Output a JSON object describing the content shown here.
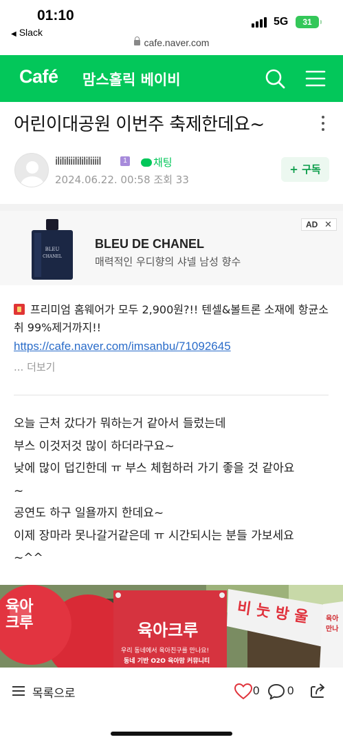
{
  "status_bar": {
    "time": "01:10",
    "back_app": "Slack",
    "network": "5G",
    "battery": "31",
    "url": "cafe.naver.com"
  },
  "header": {
    "logo": "Café",
    "cafe_name": "맘스홀릭 베이비"
  },
  "post": {
    "title": "어린이대공원 이번주 축제한데요~",
    "author": "ilililiiililililiiiil",
    "grade_badge": "1",
    "chat_label": "채팅",
    "date": "2024.06.22. 00:58",
    "views_label": "조회 33",
    "subscribe_label": "+ 구독"
  },
  "ad": {
    "badge": "AD",
    "close": "✕",
    "bottle_text": "BLEU\nCHANEL",
    "brand": "BLEU DE CHANEL",
    "description": "매력적인 우디향의 샤넬 남성 향수"
  },
  "promo": {
    "text": "프리미엄 홈웨어가 모두 2,900원?!! 텐셀&볼트론 소재에 항균소취 99%제거까지!!",
    "link": "https://cafe.naver.com/imsanbu/71092645",
    "more": "... 더보기"
  },
  "body": {
    "lines": [
      "오늘 근처 갔다가 뭐하는거 같아서 들렀는데",
      "부스 이것저것 많이 하더라구요~",
      "낮에 많이 덥긴한데 ㅠ 부스 체험하러 가기 좋을 것 같아요",
      "~",
      "공연도 하구 일욜까지 한데요~",
      "이제 장마라 못나갈거같은데 ㅠ 시간되시는 분들 가보세요",
      "~^^"
    ]
  },
  "photo": {
    "balloon_text": "육아\n크루",
    "banner_title": "육아크루",
    "banner_line1": "우리 동네에서 육아친구를 만나요!",
    "banner_line2": "동네 기반 O2O 육아맘 커뮤니티",
    "sign_text": "비 눗 방 울",
    "right_text": "육아 만나"
  },
  "bottom_bar": {
    "list_label": "목록으로",
    "like_count": "0",
    "comment_count": "0"
  },
  "colors": {
    "brand_green": "#03c75a",
    "link_blue": "#2a6cc9",
    "like_red": "#e0333b"
  }
}
